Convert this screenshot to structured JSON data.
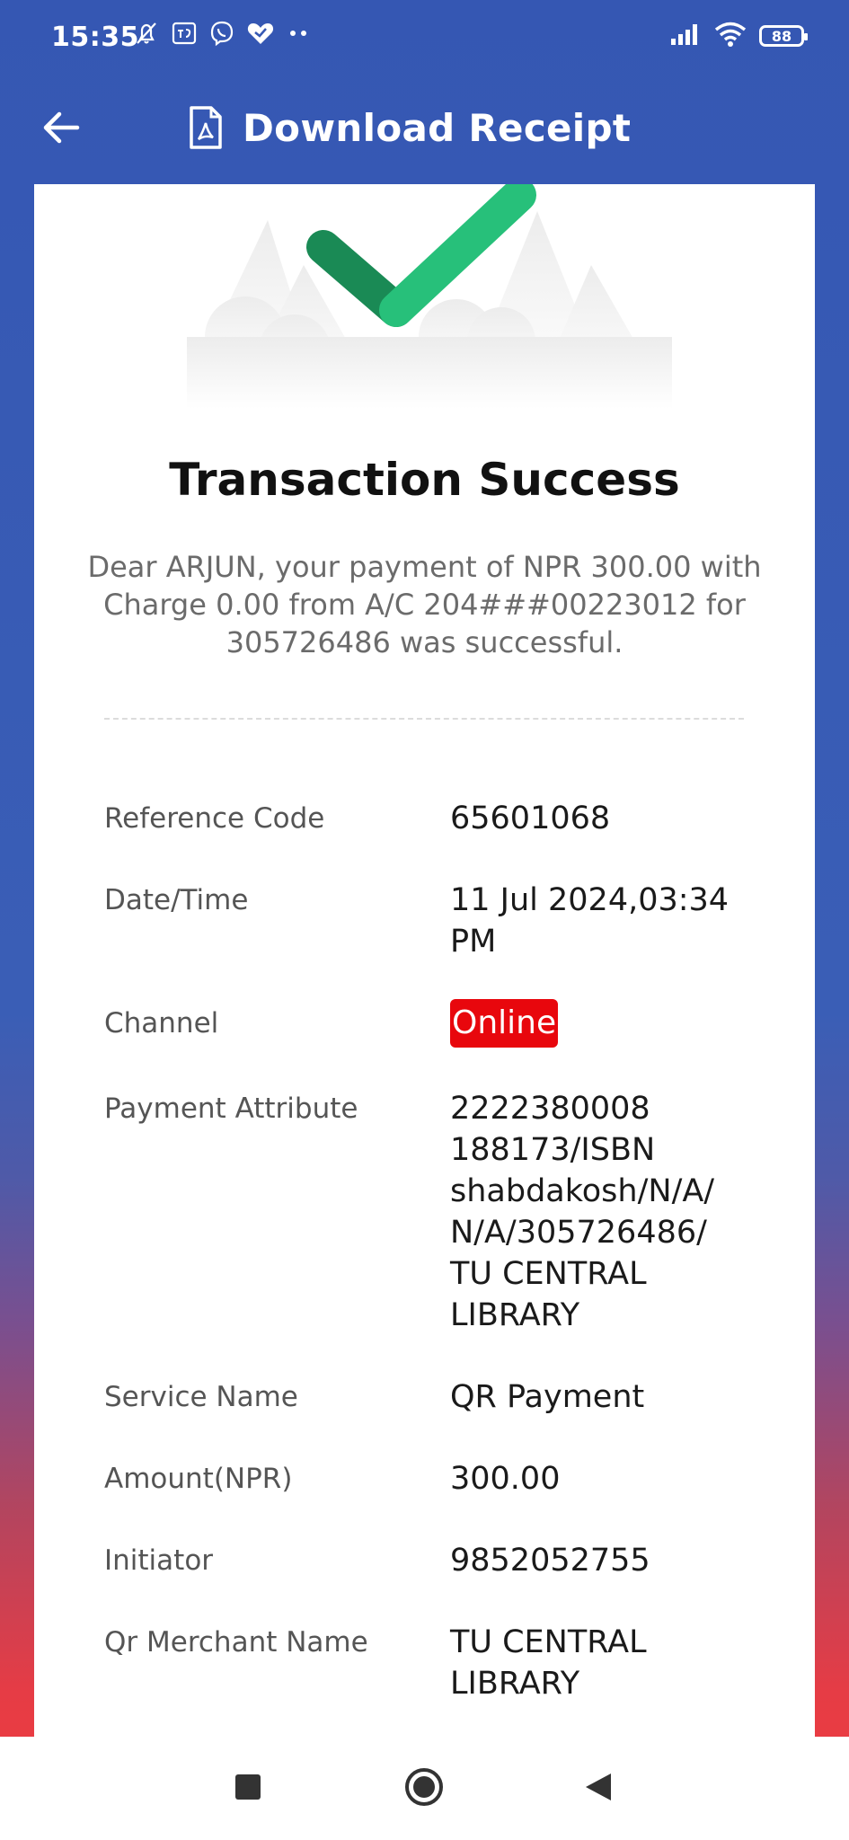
{
  "status_bar": {
    "time": "15:35",
    "battery": "88",
    "icons": [
      "bell-off-icon",
      "sim-icon",
      "viber-icon",
      "heart-icon",
      "more-dots-icon",
      "signal-icon",
      "wifi-icon",
      "battery-icon"
    ]
  },
  "app_bar": {
    "title": "Download Receipt",
    "icons": [
      "back-arrow-icon",
      "pdf-file-icon"
    ]
  },
  "receipt": {
    "title": "Transaction Success",
    "message": "Dear ARJUN, your payment of NPR 300.00 with Charge 0.00 from A/C 204###00223012 for 305726486 was successful.",
    "rows": [
      {
        "label": "Reference Code",
        "value": "65601068"
      },
      {
        "label": "Date/Time",
        "value": "11 Jul 2024,03:34 PM"
      },
      {
        "label": "Channel",
        "value": "Online"
      },
      {
        "label": "Payment Attribute",
        "value": "2222380008 188173/ISBN shabdakosh/N/A/ N/A/305726486/ TU CENTRAL LIBRARY"
      },
      {
        "label": "Service Name",
        "value": "QR Payment"
      },
      {
        "label": "Amount(NPR)",
        "value": "300.00"
      },
      {
        "label": "Initiator",
        "value": "9852052755"
      },
      {
        "label": "Qr Merchant Name",
        "value": "TU CENTRAL LIBRARY"
      }
    ]
  },
  "colors": {
    "primary": "#3557b3",
    "badge": "#e8070d",
    "check_dark": "#1a8a55",
    "check_light": "#27c07a"
  },
  "nav_bar": {
    "icons": [
      "recents-square-icon",
      "home-circle-icon",
      "back-triangle-icon"
    ]
  }
}
